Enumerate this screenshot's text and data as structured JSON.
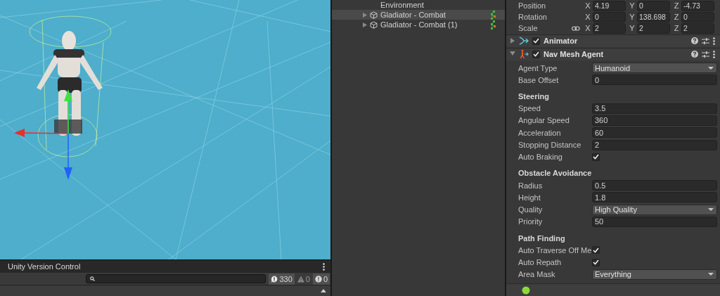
{
  "version_control": {
    "title": "Unity Version Control",
    "counters": [
      {
        "kind": "info",
        "count": "330"
      },
      {
        "kind": "warning",
        "count": "0"
      },
      {
        "kind": "error",
        "count": "0"
      }
    ]
  },
  "hierarchy": {
    "items": [
      {
        "label": "Environment",
        "selected": false,
        "kind": "object"
      },
      {
        "label": "Gladiator - Combat",
        "selected": true,
        "kind": "prefab"
      },
      {
        "label": "Gladiator - Combat (1)",
        "selected": false,
        "kind": "prefab"
      }
    ]
  },
  "inspector": {
    "transform": [
      {
        "label": "Position",
        "linked": false,
        "axes": [
          {
            "axis": "X",
            "value": "4.19"
          },
          {
            "axis": "Y",
            "value": "0"
          },
          {
            "axis": "Z",
            "value": "-4.73"
          }
        ]
      },
      {
        "label": "Rotation",
        "linked": false,
        "axes": [
          {
            "axis": "X",
            "value": "0"
          },
          {
            "axis": "Y",
            "value": "138.698"
          },
          {
            "axis": "Z",
            "value": "0"
          }
        ]
      },
      {
        "label": "Scale",
        "linked": true,
        "axes": [
          {
            "axis": "X",
            "value": "2"
          },
          {
            "axis": "Y",
            "value": "2"
          },
          {
            "axis": "Z",
            "value": "2"
          }
        ]
      }
    ],
    "components": [
      {
        "kind": "animator",
        "name": "Animator",
        "enabled": true,
        "expanded": false
      },
      {
        "kind": "agent",
        "name": "Nav Mesh Agent",
        "enabled": true,
        "expanded": true
      }
    ],
    "fields": [
      {
        "kind": "dropdown",
        "label": "Agent Type",
        "value": "Humanoid"
      },
      {
        "kind": "number",
        "label": "Base Offset",
        "value": "0"
      },
      {
        "kind": "header",
        "label": "Steering"
      },
      {
        "kind": "number",
        "label": "Speed",
        "value": "3.5"
      },
      {
        "kind": "number",
        "label": "Angular Speed",
        "value": "360"
      },
      {
        "kind": "number",
        "label": "Acceleration",
        "value": "60"
      },
      {
        "kind": "number",
        "label": "Stopping Distance",
        "value": "2"
      },
      {
        "kind": "checkbox",
        "label": "Auto Braking",
        "checked": true
      },
      {
        "kind": "header",
        "label": "Obstacle Avoidance"
      },
      {
        "kind": "number",
        "label": "Radius",
        "value": "0.5"
      },
      {
        "kind": "number",
        "label": "Height",
        "value": "1.8"
      },
      {
        "kind": "dropdown",
        "label": "Quality",
        "value": "High Quality"
      },
      {
        "kind": "number",
        "label": "Priority",
        "value": "50"
      },
      {
        "kind": "header",
        "label": "Path Finding"
      },
      {
        "kind": "checkbox",
        "label": "Auto Traverse Off Me",
        "checked": true
      },
      {
        "kind": "checkbox",
        "label": "Auto Repath",
        "checked": true
      },
      {
        "kind": "dropdown",
        "label": "Area Mask",
        "value": "Everything"
      }
    ]
  }
}
